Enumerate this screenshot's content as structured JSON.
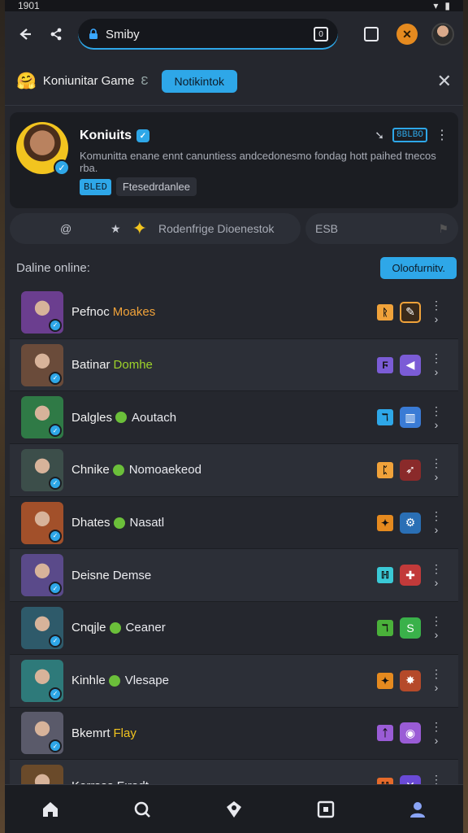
{
  "status": {
    "time": "1901"
  },
  "topbar": {
    "search_value": "Smiby",
    "search_placeholder": ""
  },
  "group": {
    "emoji": "🤗",
    "title": "Koniunitar Game",
    "title_suffix": "Ɛ",
    "notif_button": "Notikintok"
  },
  "profile": {
    "name": "Koniuits",
    "description": "Komunitta enane ennt canuntiess andcedonesmo fondag hott paihed tnecos rba.",
    "tag_code": "BLED",
    "tag_text": "Ftesedrdanlee",
    "code_badge": "8BLBO"
  },
  "actions": {
    "pill_text": "Rodenfrige Dioenestok",
    "side_text": "ESB"
  },
  "section": {
    "label": "Daline online:",
    "button": "Oloofurnitv."
  },
  "rows": [
    {
      "name": "Pefnoc",
      "sub": "Moakes",
      "sub_color": "orange",
      "has_dot": false,
      "sq_color": "#f0a23a",
      "sq_glyph": "ᚱ",
      "big_color": "#3a2a1a",
      "big_glyph": "✎",
      "big_border": "#f0a23a",
      "avatar": "#6b3e8f"
    },
    {
      "name": "Batinar",
      "sub": "Domhe",
      "sub_color": "lime",
      "has_dot": false,
      "sq_color": "#7b5cd6",
      "sq_glyph": "Ϝ",
      "big_color": "#7b5cd6",
      "big_glyph": "◀",
      "big_border": "#7b5cd6",
      "avatar": "#6a4b3a"
    },
    {
      "name": "Dalgles",
      "sub": "Aoutach",
      "sub_color": "white",
      "has_dot": true,
      "sq_color": "#2ea7e8",
      "sq_glyph": "ℸ",
      "big_color": "#3a7bd5",
      "big_glyph": "▥",
      "big_border": "#3a7bd5",
      "avatar": "#2f7a46"
    },
    {
      "name": "Chnike",
      "sub": "Nomoaekeod",
      "sub_color": "white",
      "has_dot": true,
      "sq_color": "#f0a23a",
      "sq_glyph": "ᛈ",
      "big_color": "#8a2a2a",
      "big_glyph": "➶",
      "big_border": "#8a2a2a",
      "avatar": "#3c4e4a"
    },
    {
      "name": "Dhates",
      "sub": "Nasatl",
      "sub_color": "white",
      "has_dot": true,
      "sq_color": "#e58a1f",
      "sq_glyph": "✦",
      "big_color": "#2a6fb5",
      "big_glyph": "⚙",
      "big_border": "#2a6fb5",
      "avatar": "#a2502a"
    },
    {
      "name": "Deisne",
      "sub": "Demse",
      "sub_color": "white",
      "has_dot": false,
      "sq_color": "#3ac9d6",
      "sq_glyph": "ℍ",
      "big_color": "#c23a3a",
      "big_glyph": "✚",
      "big_border": "#c23a3a",
      "avatar": "#5a4a8a"
    },
    {
      "name": "Cnqjle",
      "sub": "Ceaner",
      "sub_color": "white",
      "has_dot": true,
      "sq_color": "#4ab13a",
      "sq_glyph": "ℸ",
      "big_color": "#3ab14a",
      "big_glyph": "S",
      "big_border": "#3ab14a",
      "avatar": "#2e5a6a"
    },
    {
      "name": "Kinhle",
      "sub": "Vlesape",
      "sub_color": "white",
      "has_dot": true,
      "sq_color": "#e58a1f",
      "sq_glyph": "✦",
      "big_color": "#b54a2a",
      "big_glyph": "✸",
      "big_border": "#b54a2a",
      "avatar": "#2e7a7a"
    },
    {
      "name": "Bkemrt",
      "sub": "Flay",
      "sub_color": "yellow",
      "has_dot": false,
      "sq_color": "#9a5cd6",
      "sq_glyph": "ᛏ",
      "big_color": "#9a5cd6",
      "big_glyph": "◉",
      "big_border": "#9a5cd6",
      "avatar": "#5a5a6a"
    },
    {
      "name": "Korrsas",
      "sub": "Fıradt",
      "sub_color": "white",
      "has_dot": false,
      "sq_color": "#e56a2a",
      "sq_glyph": "ℍ",
      "big_color": "#6a4ad6",
      "big_glyph": "✕",
      "big_border": "#6a4ad6",
      "avatar": "#6a4a2a"
    }
  ],
  "bottomnav": [
    "home-icon",
    "search-icon",
    "shield-icon",
    "square-icon",
    "profile-icon"
  ]
}
